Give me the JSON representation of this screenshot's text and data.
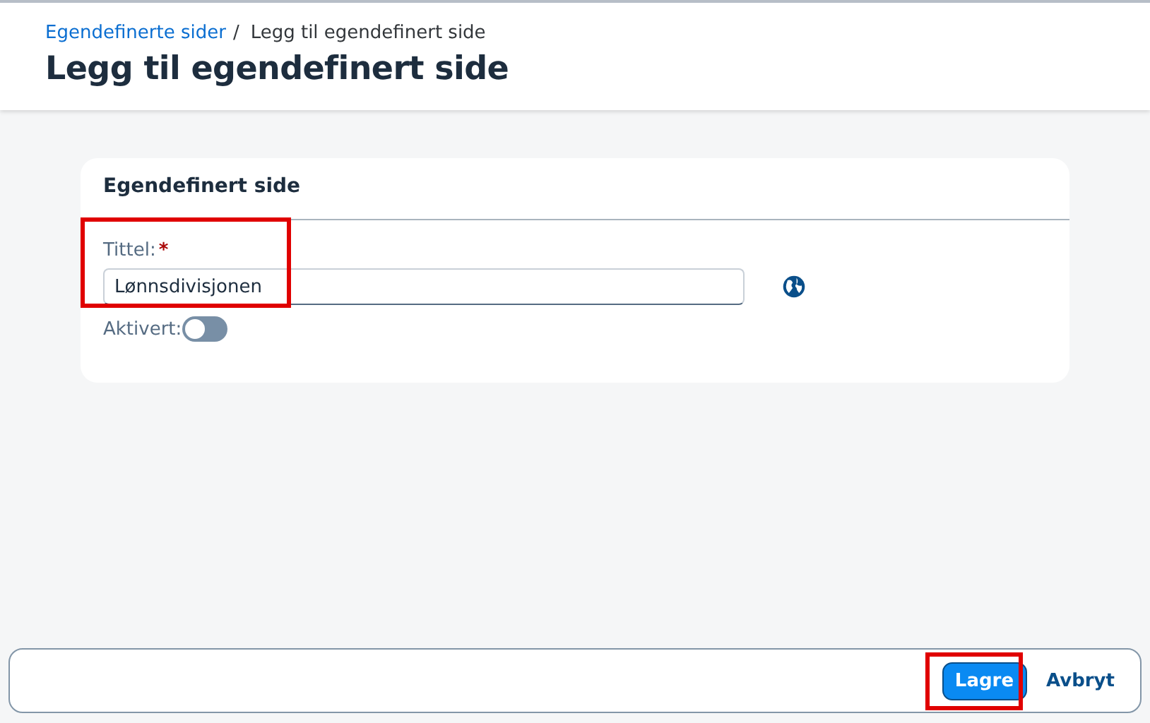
{
  "breadcrumb": [
    {
      "label": "Egendefinerte sider",
      "kind": "link"
    },
    {
      "label": "Legg til egendefinert side",
      "kind": "current"
    }
  ],
  "breadcrumb_separator": "/",
  "page_title": "Legg til egendefinert side",
  "card": {
    "title": "Egendefinert side",
    "title_field": {
      "label": "Tittel:",
      "required_mark": "*",
      "value": "Lønnsdivisjonen",
      "highlighted": true
    },
    "toggle": {
      "label": "Aktivert:",
      "on": false
    }
  },
  "footer": {
    "buttons": [
      {
        "label": "Lagre",
        "kind": "primary",
        "highlighted": true
      },
      {
        "label": "Avbryt",
        "kind": "link",
        "highlighted": false
      }
    ]
  }
}
